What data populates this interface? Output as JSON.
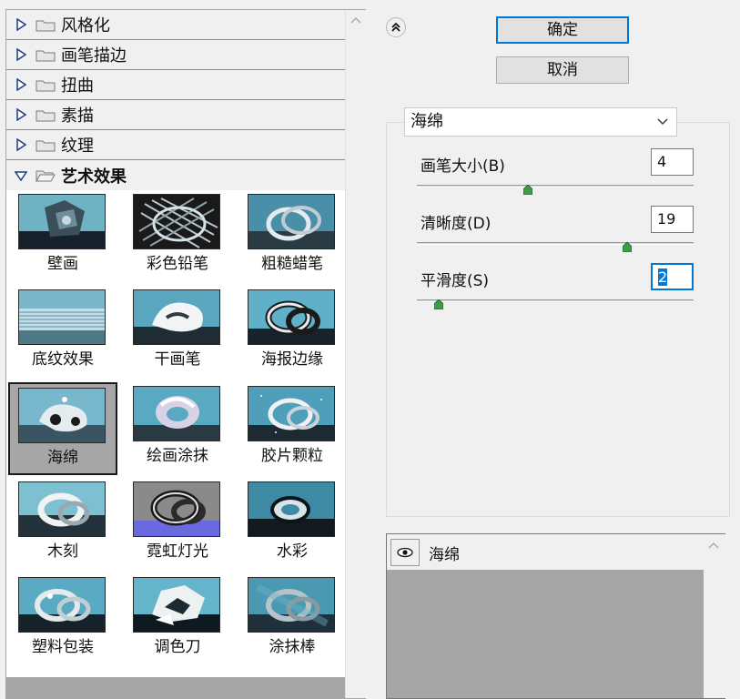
{
  "filter_tree": {
    "folders": [
      {
        "label": "风格化",
        "expanded": false
      },
      {
        "label": "画笔描边",
        "expanded": false
      },
      {
        "label": "扭曲",
        "expanded": false
      },
      {
        "label": "素描",
        "expanded": false
      },
      {
        "label": "纹理",
        "expanded": false
      },
      {
        "label": "艺术效果",
        "expanded": true
      }
    ],
    "artistic_filters": [
      {
        "label": "壁画",
        "selected": false
      },
      {
        "label": "彩色铅笔",
        "selected": false
      },
      {
        "label": "粗糙蜡笔",
        "selected": false
      },
      {
        "label": "底纹效果",
        "selected": false
      },
      {
        "label": "干画笔",
        "selected": false
      },
      {
        "label": "海报边缘",
        "selected": false
      },
      {
        "label": "海绵",
        "selected": true
      },
      {
        "label": "绘画涂抹",
        "selected": false
      },
      {
        "label": "胶片颗粒",
        "selected": false
      },
      {
        "label": "木刻",
        "selected": false
      },
      {
        "label": "霓虹灯光",
        "selected": false
      },
      {
        "label": "水彩",
        "selected": false
      },
      {
        "label": "塑料包装",
        "selected": false
      },
      {
        "label": "调色刀",
        "selected": false
      },
      {
        "label": "涂抹棒",
        "selected": false
      }
    ]
  },
  "buttons": {
    "ok": "确定",
    "cancel": "取消",
    "collapse_icon": "double-chevron-up-icon"
  },
  "settings": {
    "filter_select": {
      "value": "海绵"
    },
    "params": [
      {
        "label": "画笔大小(B)",
        "value": "4",
        "level": 0.4
      },
      {
        "label": "清晰度(D)",
        "value": "19",
        "level": 0.76
      },
      {
        "label": "平滑度(S)",
        "value": "2",
        "level": 0.08,
        "focused": true
      }
    ]
  },
  "effect_layers": [
    {
      "label": "海绵",
      "visible": true
    }
  ],
  "colors": {
    "accent": "#0078d7",
    "panel_bg": "#f0f0f0",
    "selection_bg": "#a6a6a6",
    "slider_knob": "#3f9a4a"
  }
}
